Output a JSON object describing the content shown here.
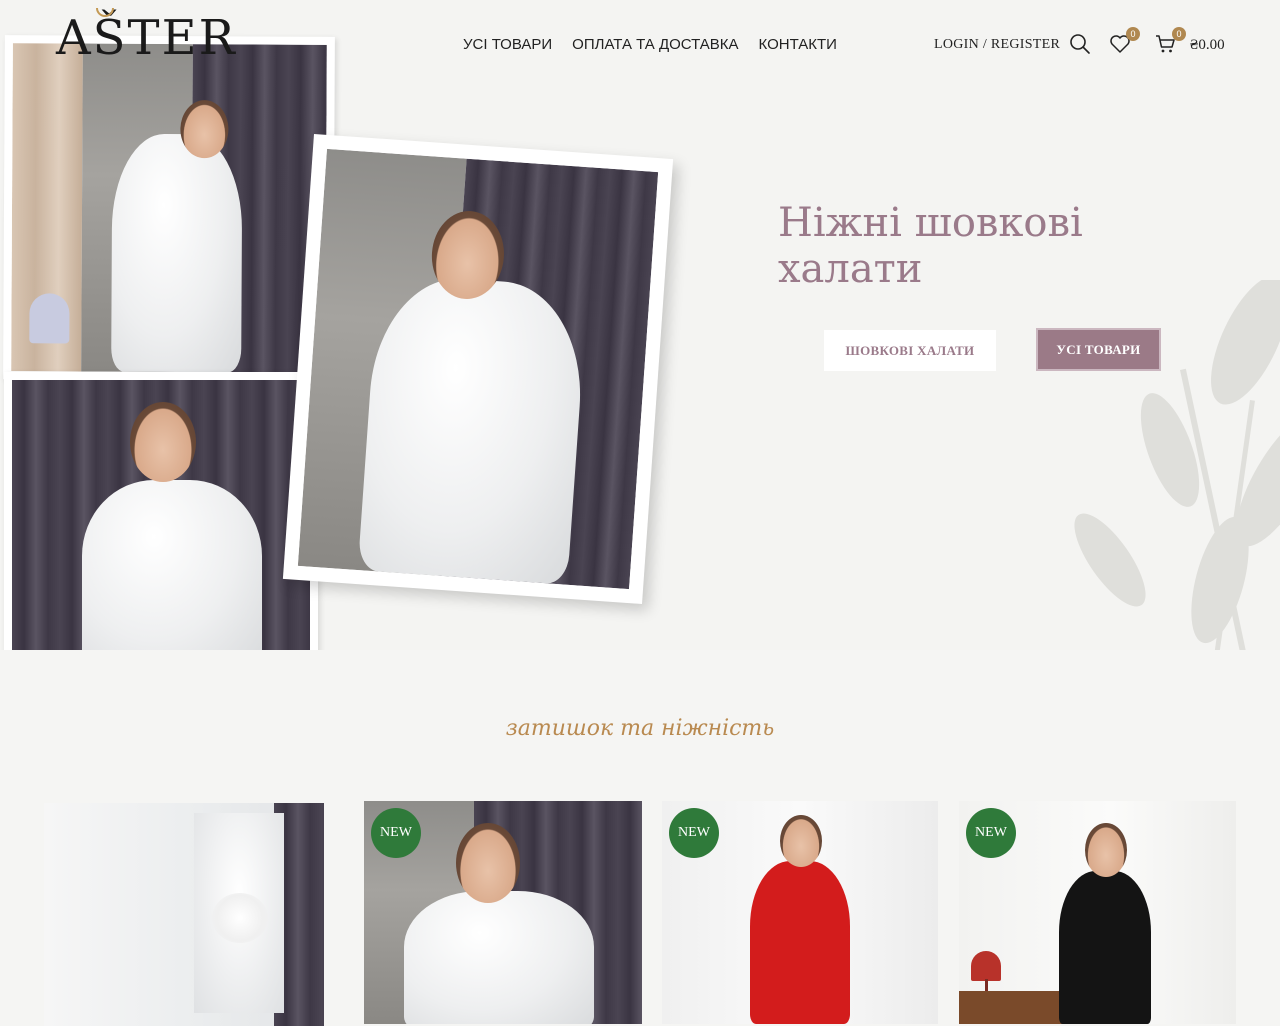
{
  "brand": {
    "logo_text": "AŠTER"
  },
  "nav": {
    "items": [
      "УСІ ТОВАРИ",
      "ОПЛАТА ТА ДОСТАВКА",
      "КОНТАКТИ"
    ]
  },
  "header": {
    "login_label": "LOGIN / REGISTER",
    "wishlist_count": "0",
    "cart_count": "0",
    "cart_total": "₴0.00",
    "icons": [
      "search-icon",
      "heart-icon",
      "cart-icon"
    ]
  },
  "hero": {
    "title": "Ніжні шовкові халати",
    "button_primary": "ШОВКОВІ ХАЛАТИ",
    "button_secondary": "УСІ ТОВАРИ"
  },
  "section": {
    "title": "затишок та ніжність",
    "products": [
      {
        "badge": ""
      },
      {
        "badge": "NEW"
      },
      {
        "badge": "NEW"
      },
      {
        "badge": "NEW"
      }
    ]
  },
  "colors": {
    "accent_mauve": "#9b7a87",
    "title_mauve": "#9a7a8a",
    "section_gold": "#b98a50",
    "badge_green": "#2f7a3a",
    "counter_gold": "#b08850"
  }
}
